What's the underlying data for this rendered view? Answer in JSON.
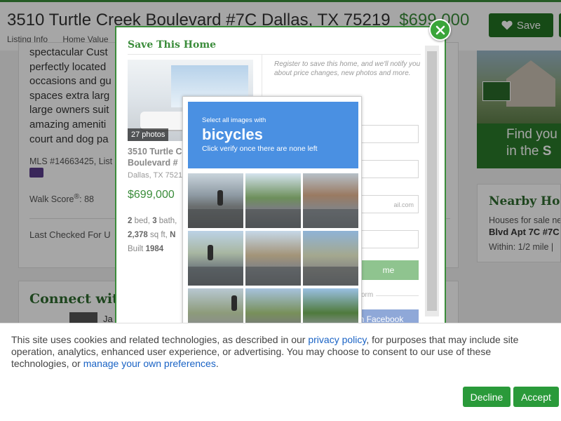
{
  "header": {
    "address": "3510 Turtle Creek Boulevard #7C Dallas, TX 75219",
    "price": "$699,000",
    "save_label": "Save",
    "subnav": [
      "Listing Info",
      "Home Value"
    ]
  },
  "details": {
    "description_lines": [
      "spectacular Cust",
      "perfectly located",
      "occasions and gu",
      "spaces extra larg",
      "large owners suit",
      "amazing ameniti",
      "court and dog pa"
    ],
    "mls": "MLS #14663425, List",
    "walk_score_label": "Walk Score",
    "walk_score_sup": "®",
    "walk_score_value": ": 88",
    "last_checked": "Last Checked For U"
  },
  "connect": {
    "title": "Connect wit",
    "agent_name": "Ja"
  },
  "ad": {
    "line1": "Find you",
    "line2_prefix": "in the ",
    "line2_bold": "S"
  },
  "nearby": {
    "title": "Nearby Ho",
    "line1": "Houses for sale ne",
    "line2": "Blvd Apt 7C #7C",
    "line3": "Within: 1/2 mile  |"
  },
  "modal": {
    "title": "Save This Home",
    "photos_badge": "27 photos",
    "listing_address": "3510 Turtle C\nBoulevard #",
    "listing_city": "Dallas, TX 7521",
    "listing_price": "$699,000",
    "beds": "2",
    "beds_label": " bed, ",
    "baths": "3",
    "baths_label": " bath,",
    "sqft": "2,378",
    "sqft_label": " sq ft, ",
    "sqft_tail": "N",
    "built_label": "Built ",
    "built_year": "1984",
    "register_text": "Register to save this home, and we'll notify you about price changes, new photos and more.",
    "email_placeholder": "ail.com",
    "submit_label": "me",
    "or_text": "orm",
    "facebook_label": "n Facebook"
  },
  "captcha": {
    "instruction_line1": "Select all images with",
    "target": "bicycles",
    "instruction_line3": "Click verify once there are none left"
  },
  "cookie": {
    "text_1": "This site uses cookies and related technologies, as described in our ",
    "privacy_link": "privacy policy",
    "text_2": ", for purposes that may include site operation, analytics, enhanced user experience, or advertising. You may choose to consent to our use of these technologies, or ",
    "prefs_link": "manage your own preferences",
    "text_3": ".",
    "decline_label": "Decline",
    "accept_label": "Accept"
  },
  "colors": {
    "brand_green": "#3a8c3a",
    "button_green": "#2a9a3a",
    "captcha_blue": "#4a90e2",
    "link_blue": "#1a63c5"
  },
  "icons": {
    "save": "heart-icon",
    "close": "close-icon"
  }
}
